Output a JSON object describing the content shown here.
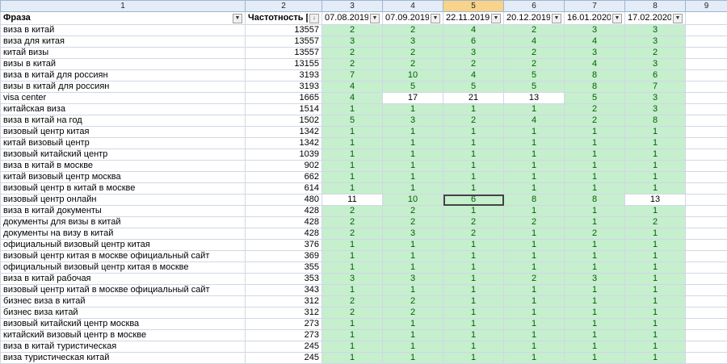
{
  "column_numbers": [
    "1",
    "2",
    "3",
    "4",
    "5",
    "6",
    "7",
    "8",
    "9"
  ],
  "selected_column_index": 4,
  "headers": {
    "phrase": "Фраза",
    "frequency": "Частотность [WS",
    "dates": [
      "07.08.2019",
      "07.09.2019",
      "22.11.2019",
      "20.12.2019",
      "16.01.2020",
      "17.02.2020"
    ]
  },
  "colors": {
    "good": "#c6efce",
    "good_text": "#006100"
  },
  "rows": [
    {
      "phrase": "виза в китай",
      "freq": "13557",
      "pos": [
        "2",
        "2",
        "4",
        "2",
        "3",
        "3"
      ],
      "white": []
    },
    {
      "phrase": "виза для китая",
      "freq": "13557",
      "pos": [
        "3",
        "3",
        "6",
        "4",
        "4",
        "3"
      ],
      "white": []
    },
    {
      "phrase": "китай визы",
      "freq": "13557",
      "pos": [
        "2",
        "2",
        "3",
        "2",
        "3",
        "2"
      ],
      "white": []
    },
    {
      "phrase": "визы в китай",
      "freq": "13155",
      "pos": [
        "2",
        "2",
        "2",
        "2",
        "4",
        "3"
      ],
      "white": []
    },
    {
      "phrase": "виза в китай для россиян",
      "freq": "3193",
      "pos": [
        "7",
        "10",
        "4",
        "5",
        "8",
        "6"
      ],
      "white": []
    },
    {
      "phrase": "визы в китай для россиян",
      "freq": "3193",
      "pos": [
        "4",
        "5",
        "5",
        "5",
        "8",
        "7"
      ],
      "white": []
    },
    {
      "phrase": "visa center",
      "freq": "1665",
      "pos": [
        "4",
        "17",
        "21",
        "13",
        "5",
        "3"
      ],
      "white": [
        1,
        2,
        3
      ]
    },
    {
      "phrase": "китайская виза",
      "freq": "1514",
      "pos": [
        "1",
        "1",
        "1",
        "1",
        "2",
        "3"
      ],
      "white": []
    },
    {
      "phrase": "виза в китай на год",
      "freq": "1502",
      "pos": [
        "5",
        "3",
        "2",
        "4",
        "2",
        "8"
      ],
      "white": []
    },
    {
      "phrase": "визовый центр китая",
      "freq": "1342",
      "pos": [
        "1",
        "1",
        "1",
        "1",
        "1",
        "1"
      ],
      "white": []
    },
    {
      "phrase": "китай визовый центр",
      "freq": "1342",
      "pos": [
        "1",
        "1",
        "1",
        "1",
        "1",
        "1"
      ],
      "white": []
    },
    {
      "phrase": "визовый китайский центр",
      "freq": "1039",
      "pos": [
        "1",
        "1",
        "1",
        "1",
        "1",
        "1"
      ],
      "white": []
    },
    {
      "phrase": "виза в китай в москве",
      "freq": "902",
      "pos": [
        "1",
        "1",
        "1",
        "1",
        "1",
        "1"
      ],
      "white": []
    },
    {
      "phrase": "китай визовый центр москва",
      "freq": "662",
      "pos": [
        "1",
        "1",
        "1",
        "1",
        "1",
        "1"
      ],
      "white": []
    },
    {
      "phrase": "визовый центр в китай в москве",
      "freq": "614",
      "pos": [
        "1",
        "1",
        "1",
        "1",
        "1",
        "1"
      ],
      "white": []
    },
    {
      "phrase": "визовый центр онлайн",
      "freq": "480",
      "pos": [
        "11",
        "10",
        "6",
        "8",
        "8",
        "13"
      ],
      "white": [
        0,
        5
      ]
    },
    {
      "phrase": "виза в китай документы",
      "freq": "428",
      "pos": [
        "2",
        "2",
        "1",
        "1",
        "1",
        "1"
      ],
      "white": []
    },
    {
      "phrase": "документы для визы в китай",
      "freq": "428",
      "pos": [
        "2",
        "2",
        "2",
        "2",
        "1",
        "2"
      ],
      "white": []
    },
    {
      "phrase": "документы на визу в китай",
      "freq": "428",
      "pos": [
        "2",
        "3",
        "2",
        "1",
        "2",
        "1"
      ],
      "white": []
    },
    {
      "phrase": "официальный визовый центр китая",
      "freq": "376",
      "pos": [
        "1",
        "1",
        "1",
        "1",
        "1",
        "1"
      ],
      "white": []
    },
    {
      "phrase": "визовый центр китая в москве официальный сайт",
      "freq": "369",
      "pos": [
        "1",
        "1",
        "1",
        "1",
        "1",
        "1"
      ],
      "white": []
    },
    {
      "phrase": "официальный визовый центр китая в москве",
      "freq": "355",
      "pos": [
        "1",
        "1",
        "1",
        "1",
        "1",
        "1"
      ],
      "white": []
    },
    {
      "phrase": "виза в китай рабочая",
      "freq": "353",
      "pos": [
        "3",
        "3",
        "1",
        "2",
        "3",
        "1"
      ],
      "white": []
    },
    {
      "phrase": "визовый центр китай в москве официальный сайт",
      "freq": "343",
      "pos": [
        "1",
        "1",
        "1",
        "1",
        "1",
        "1"
      ],
      "white": []
    },
    {
      "phrase": "бизнес виза в китай",
      "freq": "312",
      "pos": [
        "2",
        "2",
        "1",
        "1",
        "1",
        "1"
      ],
      "white": []
    },
    {
      "phrase": "бизнес виза китай",
      "freq": "312",
      "pos": [
        "2",
        "2",
        "1",
        "1",
        "1",
        "1"
      ],
      "white": []
    },
    {
      "phrase": "визовый китайский центр москва",
      "freq": "273",
      "pos": [
        "1",
        "1",
        "1",
        "1",
        "1",
        "1"
      ],
      "white": []
    },
    {
      "phrase": "китайский визовый центр в москве",
      "freq": "273",
      "pos": [
        "1",
        "1",
        "1",
        "1",
        "1",
        "1"
      ],
      "white": []
    },
    {
      "phrase": "виза в китай туристическая",
      "freq": "245",
      "pos": [
        "1",
        "1",
        "1",
        "1",
        "1",
        "1"
      ],
      "white": []
    },
    {
      "phrase": "виза туристическая китай",
      "freq": "245",
      "pos": [
        "1",
        "1",
        "1",
        "1",
        "1",
        "1"
      ],
      "white": []
    }
  ]
}
